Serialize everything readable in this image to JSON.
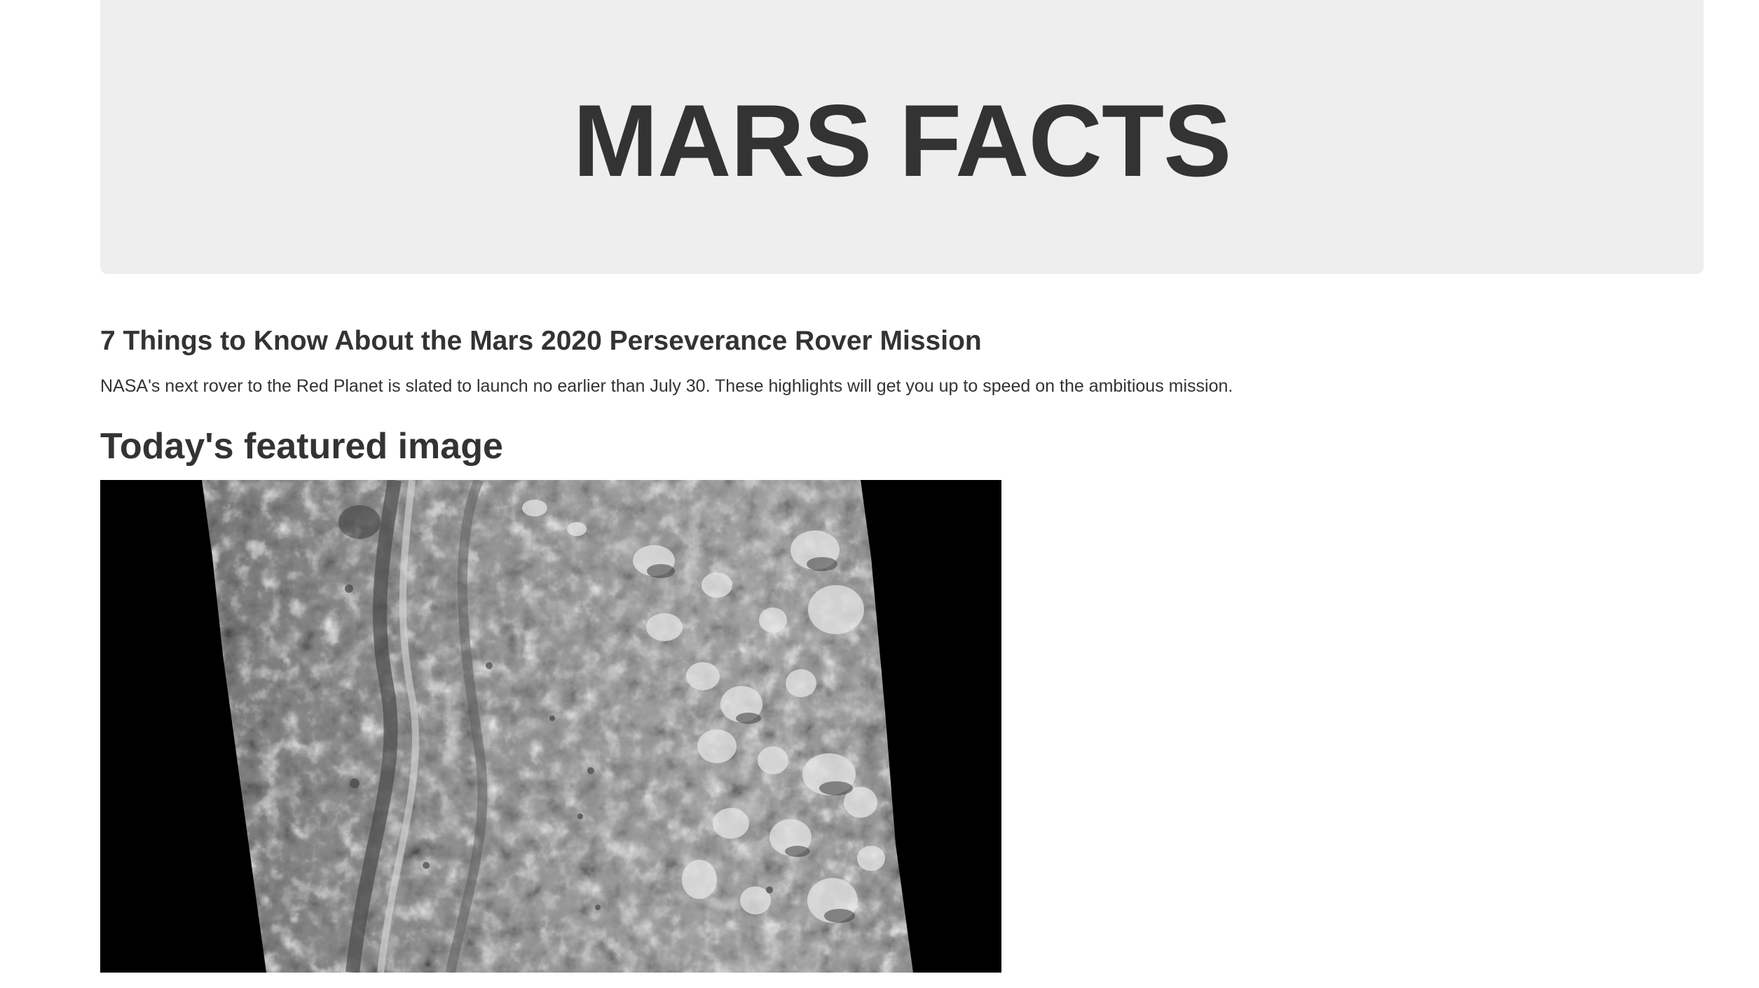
{
  "header": {
    "title": "MARS FACTS"
  },
  "news": {
    "title": "7 Things to Know About the Mars 2020 Perseverance Rover Mission",
    "teaser": "NASA's next rover to the Red Planet is slated to launch no earlier than July 30. These highlights will get you up to speed on the ambitious mission."
  },
  "featured": {
    "heading": "Today's featured image"
  },
  "colors": {
    "background": "#ffffff",
    "jumbotron": "#eeeeee",
    "text": "#333333",
    "image_border": "#000000"
  }
}
